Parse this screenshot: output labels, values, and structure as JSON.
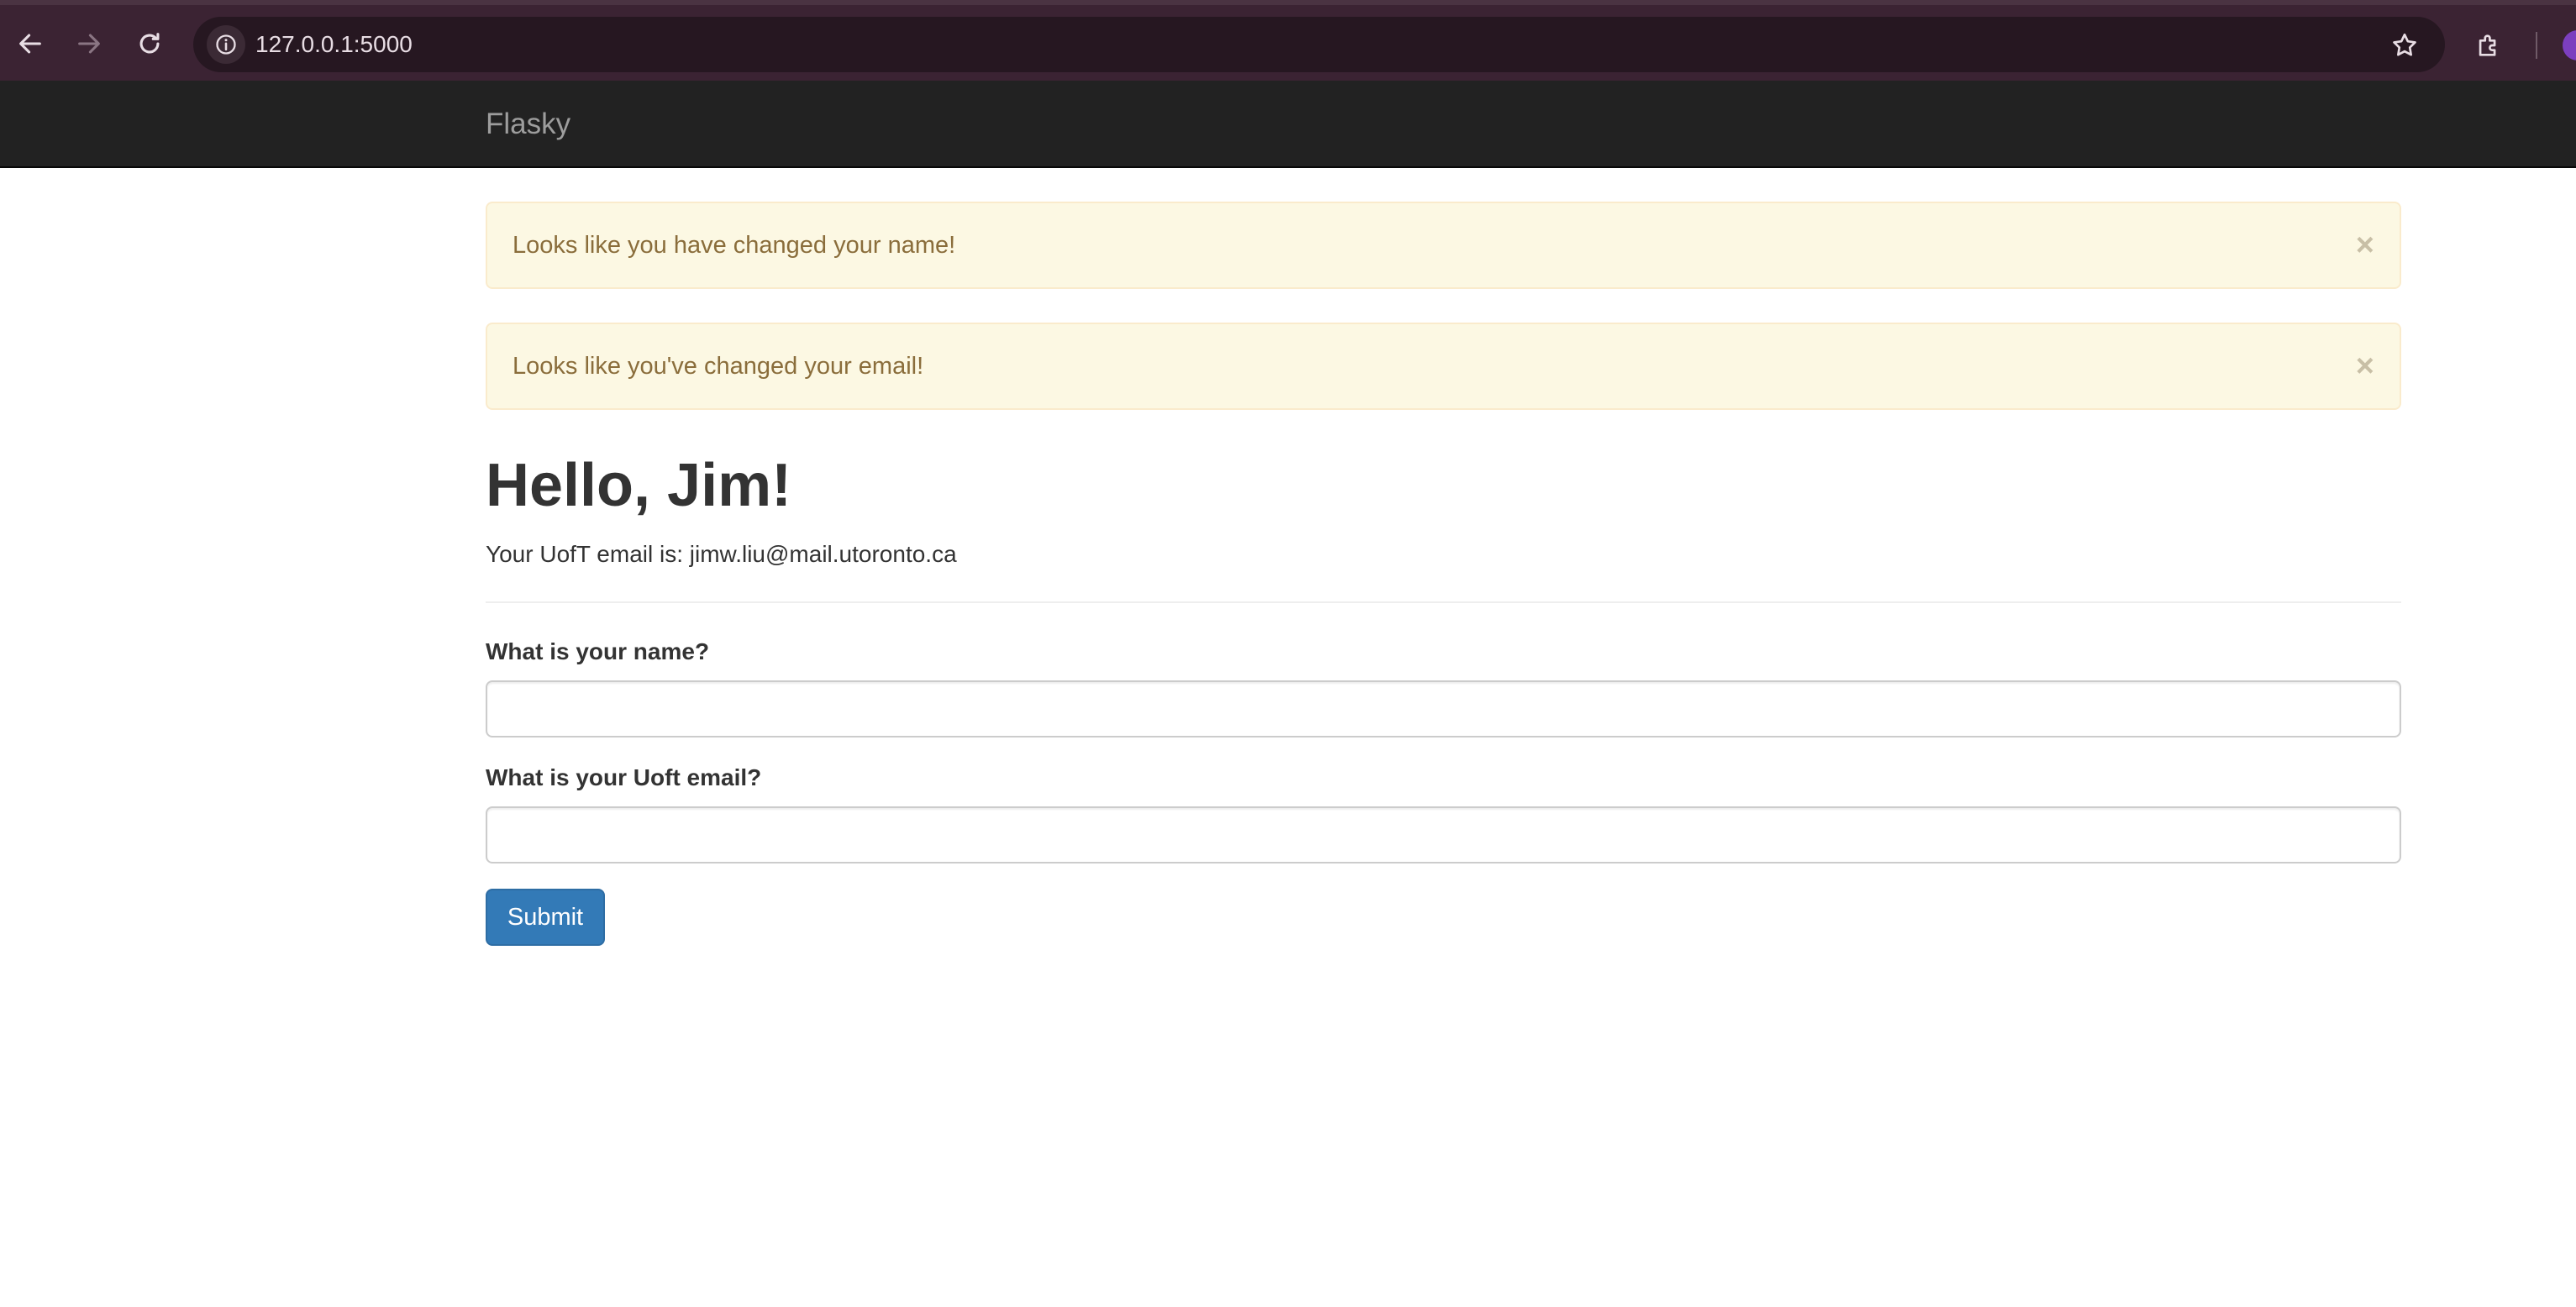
{
  "browser": {
    "url": "127.0.0.1:5000"
  },
  "navbar": {
    "brand": "Flasky"
  },
  "alerts": [
    {
      "message": "Looks like you have changed your name!",
      "close": "×"
    },
    {
      "message": "Looks like you've changed your email!",
      "close": "×"
    }
  ],
  "header": {
    "greeting": "Hello, Jim!",
    "email_line": "Your UofT email is: jimw.liu@mail.utoronto.ca"
  },
  "form": {
    "name_label": "What is your name?",
    "name_value": "",
    "email_label": "What is your Uoft email?",
    "email_value": "",
    "submit_label": "Submit"
  },
  "colors": {
    "chrome": "#3b2333",
    "navbar": "#222222",
    "alert_bg": "#fcf8e3",
    "alert_text": "#8a6d3b",
    "primary": "#337ab7"
  }
}
